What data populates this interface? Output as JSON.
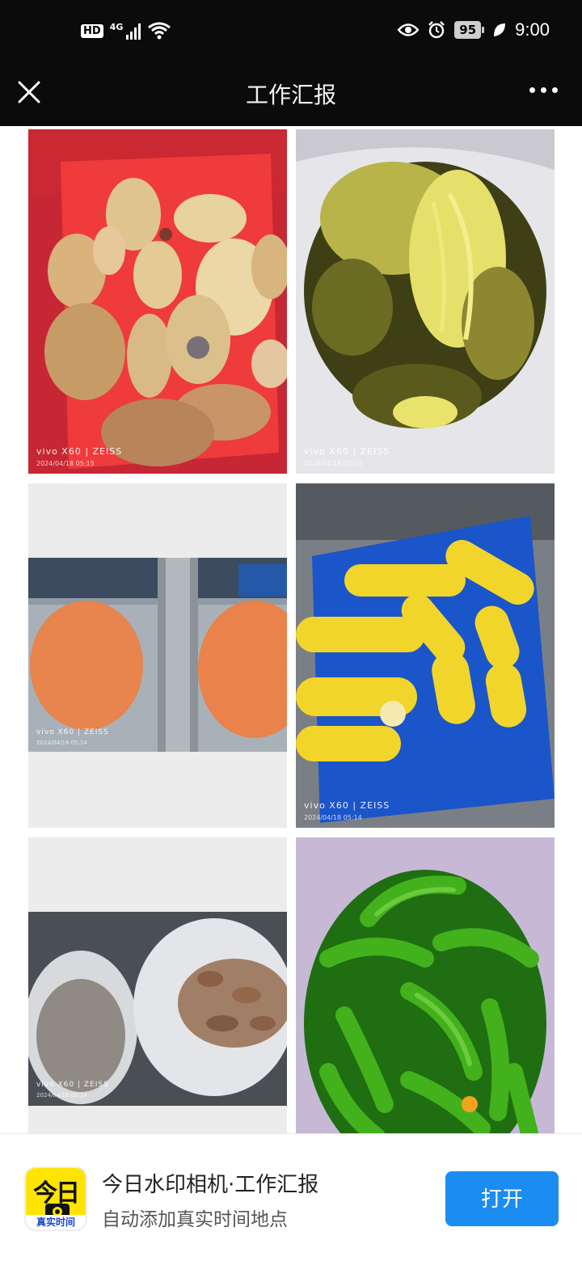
{
  "status_bar": {
    "hd_label": "HD",
    "network_label": "4G",
    "battery_level": "95",
    "time": "9:00",
    "icons": [
      "signal-icon",
      "wifi-icon",
      "eye-icon",
      "alarm-icon",
      "battery-icon",
      "leaf-icon"
    ]
  },
  "header": {
    "title": "工作汇报",
    "close_icon": "close-icon",
    "more_icon": "more-icon"
  },
  "photos": [
    {
      "subject": "lotus-root",
      "brand": "vivo X60 | ZEISS",
      "date": "2024/04/18 05:15"
    },
    {
      "subject": "pickled-mustard-greens",
      "brand": "vivo X60 | ZEISS",
      "date": "2024/04/18 05:14"
    },
    {
      "subject": "carrots",
      "brand": "vivo X60 | ZEISS",
      "date": "2024/04/18 05:14"
    },
    {
      "subject": "corn",
      "brand": "vivo X60 | ZEISS",
      "date": "2024/04/18 05:14"
    },
    {
      "subject": "sweet-potatoes",
      "brand": "vivo X60 | ZEISS",
      "date": "2024/04/18 05:14"
    },
    {
      "subject": "green-peppers",
      "brand": "",
      "date": ""
    }
  ],
  "banner": {
    "logo_main": "今日",
    "logo_sub": "真实时间",
    "title": "今日水印相机·工作汇报",
    "subtitle": "自动添加真实时间地点",
    "open_button": "打开"
  },
  "colors": {
    "header_bg": "#0b0b0b",
    "open_button": "#1b8cf2",
    "logo_yellow": "#ffe400"
  }
}
